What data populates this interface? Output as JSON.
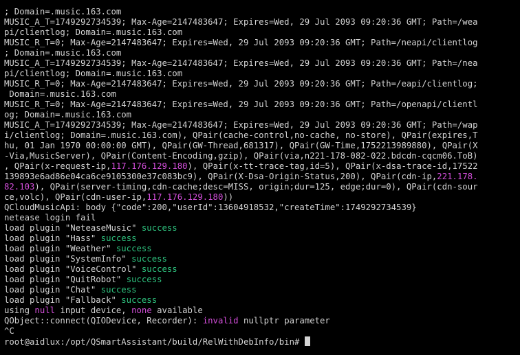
{
  "colors": {
    "background": "#000000",
    "text": "#d4d4d4",
    "success": "#2ec27e",
    "ip": "#d54fdc",
    "keyword": "#d54fdc"
  },
  "lines": [
    [
      {
        "t": "; Domain=.music.163.com"
      }
    ],
    [
      {
        "t": "MUSIC_A_T=1749292734539; Max-Age=2147483647; Expires=Wed, 29 Jul 2093 09:20:36 GMT; Path=/wea"
      }
    ],
    [
      {
        "t": "pi/clientlog; Domain=.music.163.com"
      }
    ],
    [
      {
        "t": "MUSIC_R_T=0; Max-Age=2147483647; Expires=Wed, 29 Jul 2093 09:20:36 GMT; Path=/neapi/clientlog"
      }
    ],
    [
      {
        "t": "; Domain=.music.163.com"
      }
    ],
    [
      {
        "t": "MUSIC_A_T=1749292734539; Max-Age=2147483647; Expires=Wed, 29 Jul 2093 09:20:36 GMT; Path=/nea"
      }
    ],
    [
      {
        "t": "pi/clientlog; Domain=.music.163.com"
      }
    ],
    [
      {
        "t": "MUSIC_R_T=0; Max-Age=2147483647; Expires=Wed, 29 Jul 2093 09:20:36 GMT; Path=/eapi/clientlog;"
      }
    ],
    [
      {
        "t": " Domain=.music.163.com"
      }
    ],
    [
      {
        "t": "MUSIC_R_T=0; Max-Age=2147483647; Expires=Wed, 29 Jul 2093 09:20:36 GMT; Path=/openapi/clientl"
      }
    ],
    [
      {
        "t": "og; Domain=.music.163.com"
      }
    ],
    [
      {
        "t": "MUSIC_A_T=1749292734539; Max-Age=2147483647; Expires=Wed, 29 Jul 2093 09:20:36 GMT; Path=/wap"
      }
    ],
    [
      {
        "t": "i/clientlog; Domain=.music.163.com), QPair(cache-control,no-cache, no-store), QPair(expires,T"
      }
    ],
    [
      {
        "t": "hu, 01 Jan 1970 00:00:00 GMT), QPair(GW-Thread,681317), QPair(GW-Time,1752213989880), QPair(X"
      }
    ],
    [
      {
        "t": "-Via,MusicServer), QPair(Content-Encoding,gzip), QPair(via,n221-178-082-022.bdcdn-cqcm06.ToB)"
      }
    ],
    [
      {
        "t": ", QPair(x-request-ip,"
      },
      {
        "t": "117.176.129.180",
        "c": "ip"
      },
      {
        "t": "), QPair(x-tt-trace-tag,id=5), QPair(x-dsa-trace-id,17522"
      }
    ],
    [
      {
        "t": "139893e6ad86e04ca6ce9105300e37c083bc9), QPair(X-Dsa-Origin-Status,200), QPair(cdn-ip,"
      },
      {
        "t": "221.178.",
        "c": "ip"
      }
    ],
    [
      {
        "t": "82.103",
        "c": "ip"
      },
      {
        "t": "), QPair(server-timing,cdn-cache;desc=MISS, origin;dur=125, edge;dur=0), QPair(cdn-sour"
      }
    ],
    [
      {
        "t": "ce,volc), QPair(cdn-user-ip,"
      },
      {
        "t": "117.176.129.180",
        "c": "ip"
      },
      {
        "t": "))"
      }
    ],
    [
      {
        "t": "QCloudMusicApi: body {\"code\":200,\"userId\":13604918532,\"createTime\":1749292734539}"
      }
    ],
    [
      {
        "t": "netease login fail"
      }
    ],
    [
      {
        "t": "load plugin \"NeteaseMusic\" "
      },
      {
        "t": "success",
        "c": "success"
      }
    ],
    [
      {
        "t": "load plugin \"Hass\" "
      },
      {
        "t": "success",
        "c": "success"
      }
    ],
    [
      {
        "t": "load plugin \"Weather\" "
      },
      {
        "t": "success",
        "c": "success"
      }
    ],
    [
      {
        "t": "load plugin \"SystemInfo\" "
      },
      {
        "t": "success",
        "c": "success"
      }
    ],
    [
      {
        "t": "load plugin \"VoiceControl\" "
      },
      {
        "t": "success",
        "c": "success"
      }
    ],
    [
      {
        "t": "load plugin \"QuitRobot\" "
      },
      {
        "t": "success",
        "c": "success"
      }
    ],
    [
      {
        "t": "load plugin \"Chat\" "
      },
      {
        "t": "success",
        "c": "success"
      }
    ],
    [
      {
        "t": "load plugin \"Fallback\" "
      },
      {
        "t": "success",
        "c": "success"
      }
    ],
    [
      {
        "t": "using "
      },
      {
        "t": "null",
        "c": "keyword"
      },
      {
        "t": " input device, "
      },
      {
        "t": "none",
        "c": "keyword"
      },
      {
        "t": " available"
      }
    ],
    [
      {
        "t": "QObject::connect(QIODevice, Recorder): "
      },
      {
        "t": "invalid",
        "c": "keyword"
      },
      {
        "t": " nullptr parameter"
      }
    ],
    [
      {
        "t": "^C"
      }
    ]
  ],
  "prompt": "root@aidlux:/opt/QSmartAssistant/build/RelWithDebInfo/bin# "
}
